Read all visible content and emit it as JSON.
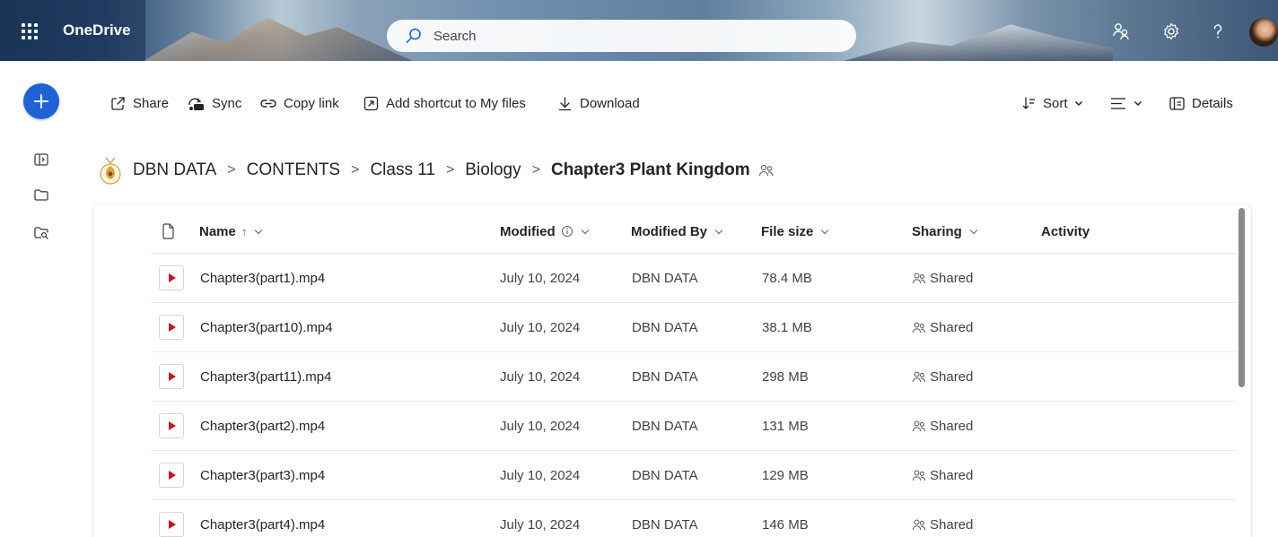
{
  "header": {
    "app_name": "OneDrive",
    "search": {
      "placeholder": "Search"
    }
  },
  "commands": {
    "share": "Share",
    "sync": "Sync",
    "copy_link": "Copy link",
    "add_shortcut": "Add shortcut to My files",
    "download": "Download",
    "sort": "Sort",
    "details": "Details"
  },
  "breadcrumb": {
    "items": [
      "DBN DATA",
      "CONTENTS",
      "Class 11",
      "Biology"
    ],
    "current": "Chapter3 Plant Kingdom"
  },
  "columns": {
    "name": "Name",
    "name_sort_arrow": "↑",
    "modified": "Modified",
    "modified_by": "Modified By",
    "file_size": "File size",
    "sharing": "Sharing",
    "activity": "Activity"
  },
  "files": [
    {
      "name": "Chapter3(part1).mp4",
      "modified": "July 10, 2024",
      "modified_by": "DBN DATA",
      "size": "78.4 MB",
      "sharing": "Shared"
    },
    {
      "name": "Chapter3(part10).mp4",
      "modified": "July 10, 2024",
      "modified_by": "DBN DATA",
      "size": "38.1 MB",
      "sharing": "Shared"
    },
    {
      "name": "Chapter3(part11).mp4",
      "modified": "July 10, 2024",
      "modified_by": "DBN DATA",
      "size": "298 MB",
      "sharing": "Shared"
    },
    {
      "name": "Chapter3(part2).mp4",
      "modified": "July 10, 2024",
      "modified_by": "DBN DATA",
      "size": "131 MB",
      "sharing": "Shared"
    },
    {
      "name": "Chapter3(part3).mp4",
      "modified": "July 10, 2024",
      "modified_by": "DBN DATA",
      "size": "129 MB",
      "sharing": "Shared"
    },
    {
      "name": "Chapter3(part4).mp4",
      "modified": "July 10, 2024",
      "modified_by": "DBN DATA",
      "size": "146 MB",
      "sharing": "Shared"
    }
  ],
  "colors": {
    "accent": "#1f62d6",
    "video_icon": "#c4162a"
  }
}
